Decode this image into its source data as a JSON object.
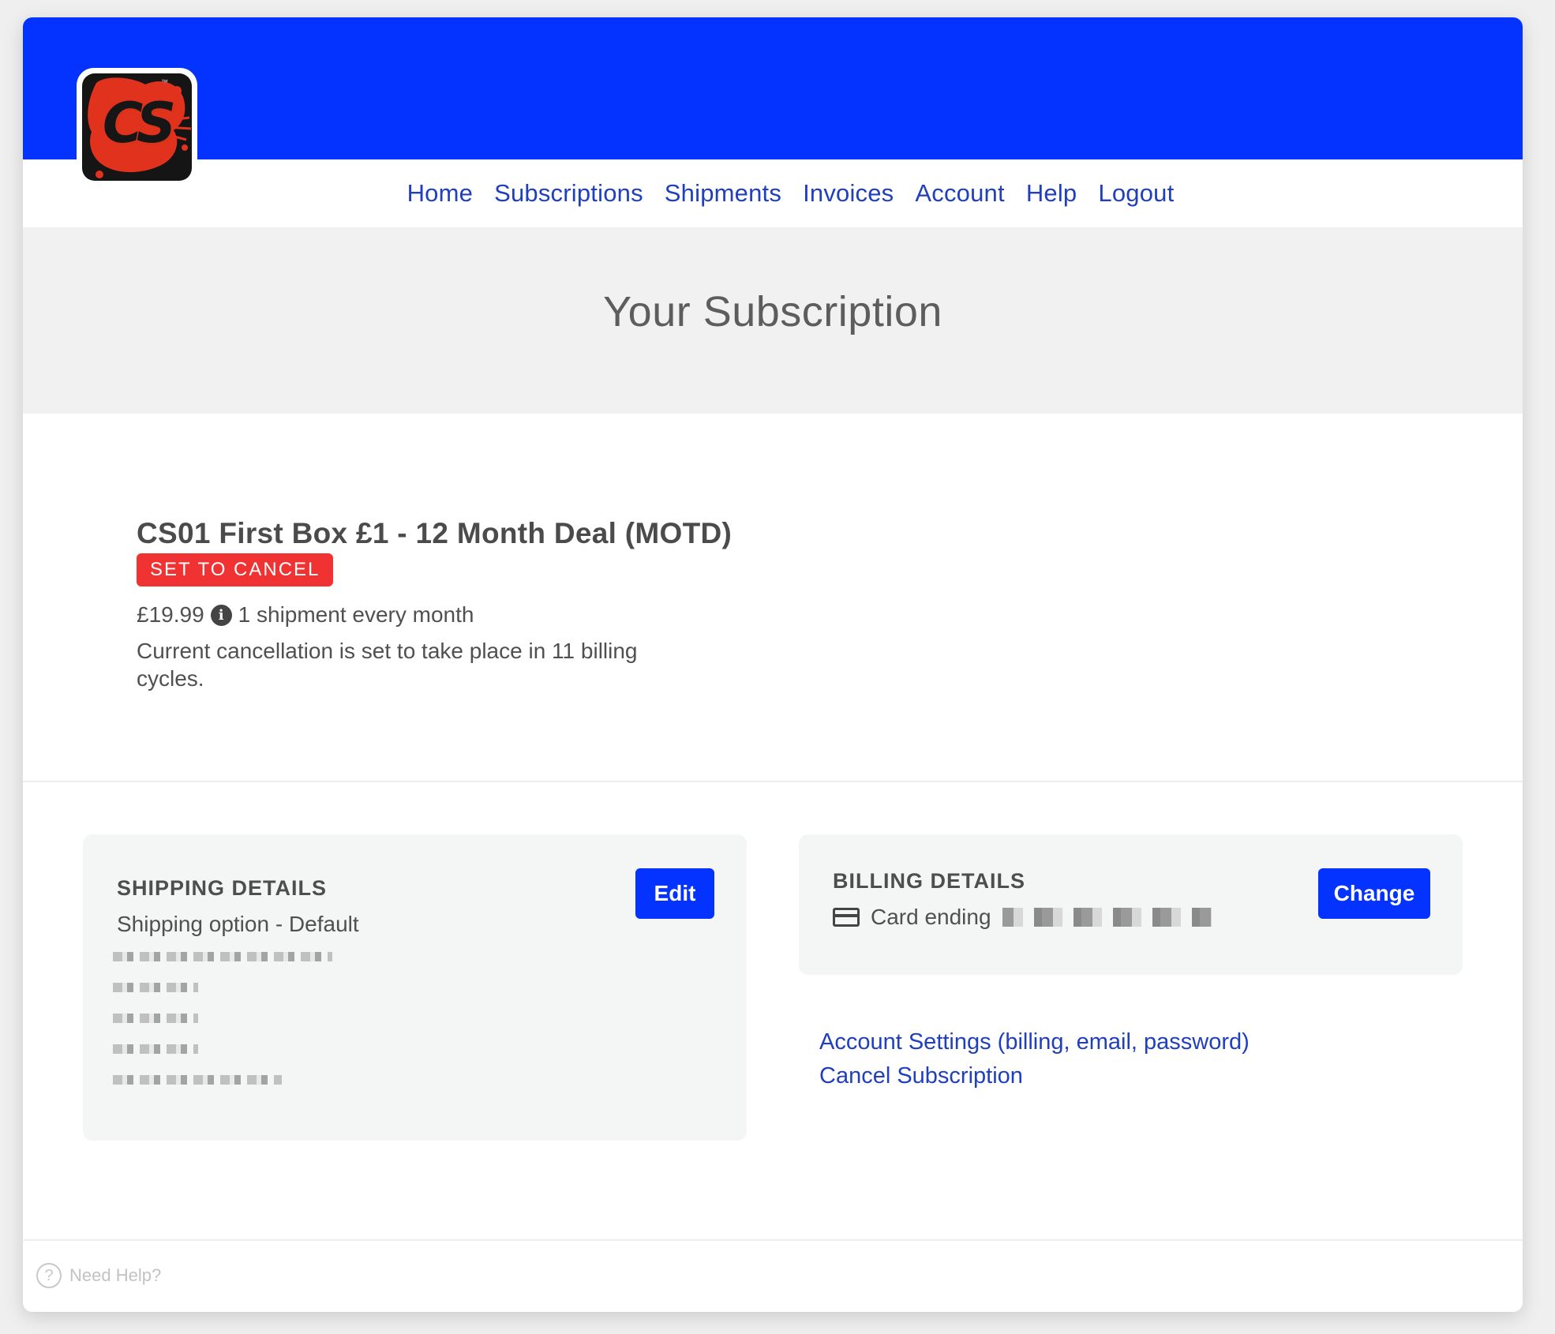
{
  "header": {
    "logo": {
      "text": "CS",
      "tm": "™",
      "colors": {
        "background": "#151515",
        "splash": "#e1321d"
      }
    },
    "banner_color": "#0432ff"
  },
  "nav": {
    "items": [
      {
        "label": "Home"
      },
      {
        "label": "Subscriptions"
      },
      {
        "label": "Shipments"
      },
      {
        "label": "Invoices"
      },
      {
        "label": "Account"
      },
      {
        "label": "Help"
      },
      {
        "label": "Logout"
      }
    ]
  },
  "page": {
    "title": "Your Subscription"
  },
  "subscription": {
    "name": "CS01 First Box £1 - 12 Month Deal (MOTD)",
    "status_badge": "SET TO CANCEL",
    "price": "£19.99",
    "frequency": "1 shipment every month",
    "cancellation_note": "Current cancellation is set to take place in 11 billing cycles."
  },
  "shipping": {
    "heading": "SHIPPING DETAILS",
    "option": "Shipping option - Default",
    "edit_label": "Edit"
  },
  "billing": {
    "heading": "BILLING DETAILS",
    "card_label": "Card ending",
    "change_label": "Change"
  },
  "links": {
    "account_settings": "Account Settings (billing, email, password)",
    "cancel_subscription": "Cancel Subscription"
  },
  "footer": {
    "help": "Need Help?",
    "help_icon": "?"
  },
  "colors": {
    "accent": "#0432ff",
    "link": "#1f3fbf",
    "danger": "#f03232"
  }
}
